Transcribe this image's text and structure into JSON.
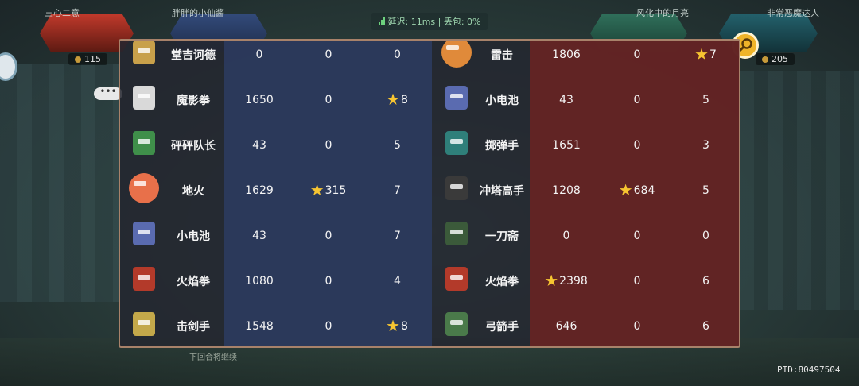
{
  "net": {
    "signal_icon": "signal-bars-icon",
    "text": "延迟: 11ms | 丢包: 0%"
  },
  "top": {
    "player_tl": "三心二意",
    "player_tl2": "胖胖的小仙酱",
    "player_tr2": "风化中的月亮",
    "player_tr": "非常恶魔达人",
    "coins_left": "115",
    "coins_right": "205"
  },
  "pid": "PID:80497504",
  "under_text": "下回合将继续",
  "colors": {
    "blue_team": "#2c3a5e",
    "red_team": "#662424",
    "star": "#f7c531",
    "border": "#a8826a"
  },
  "left_team": [
    {
      "avatar": "knight-avatar-icon",
      "name": "堂吉诃德",
      "damage": "0",
      "kills": "0",
      "kills_star": false,
      "mvp": "0",
      "mvp_star": false
    },
    {
      "avatar": "skull-fighter-avatar-icon",
      "name": "魔影拳",
      "damage": "1650",
      "kills": "0",
      "kills_star": false,
      "mvp": "8",
      "mvp_star": true
    },
    {
      "avatar": "captain-avatar-icon",
      "name": "砰砰队长",
      "damage": "43",
      "kills": "0",
      "kills_star": false,
      "mvp": "5",
      "mvp_star": false
    },
    {
      "avatar": "fireball-avatar-icon",
      "name": "地火",
      "damage": "1629",
      "kills": "315",
      "kills_star": true,
      "mvp": "7",
      "mvp_star": false
    },
    {
      "avatar": "battery-avatar-icon",
      "name": "小电池",
      "damage": "43",
      "kills": "0",
      "kills_star": false,
      "mvp": "7",
      "mvp_star": false
    },
    {
      "avatar": "flame-fist-avatar-icon",
      "name": "火焰拳",
      "damage": "1080",
      "kills": "0",
      "kills_star": false,
      "mvp": "4",
      "mvp_star": false
    },
    {
      "avatar": "swordsman-avatar-icon",
      "name": "击剑手",
      "damage": "1548",
      "kills": "0",
      "kills_star": false,
      "mvp": "8",
      "mvp_star": true
    }
  ],
  "right_team": [
    {
      "avatar": "thunder-orb-avatar-icon",
      "name": "雷击",
      "damage": "1806",
      "damage_star": false,
      "kills": "0",
      "kills_star": false,
      "mvp": "7",
      "mvp_star": true
    },
    {
      "avatar": "battery-avatar-icon",
      "name": "小电池",
      "damage": "43",
      "damage_star": false,
      "kills": "0",
      "kills_star": false,
      "mvp": "5",
      "mvp_star": false
    },
    {
      "avatar": "bomber-avatar-icon",
      "name": "掷弹手",
      "damage": "1651",
      "damage_star": false,
      "kills": "0",
      "kills_star": false,
      "mvp": "3",
      "mvp_star": false
    },
    {
      "avatar": "tower-avatar-icon",
      "name": "冲塔高手",
      "damage": "1208",
      "damage_star": false,
      "kills": "684",
      "kills_star": true,
      "mvp": "5",
      "mvp_star": false
    },
    {
      "avatar": "ninja-avatar-icon",
      "name": "一刀斋",
      "damage": "0",
      "damage_star": false,
      "kills": "0",
      "kills_star": false,
      "mvp": "0",
      "mvp_star": false
    },
    {
      "avatar": "flame-fist-avatar-icon",
      "name": "火焰拳",
      "damage": "2398",
      "damage_star": true,
      "kills": "0",
      "kills_star": false,
      "mvp": "6",
      "mvp_star": false
    },
    {
      "avatar": "archer-avatar-icon",
      "name": "弓箭手",
      "damage": "646",
      "damage_star": false,
      "kills": "0",
      "kills_star": false,
      "mvp": "6",
      "mvp_star": false
    }
  ]
}
